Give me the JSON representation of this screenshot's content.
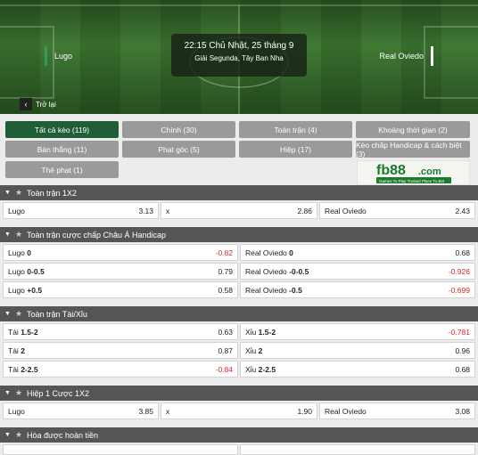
{
  "match": {
    "home": "Lugo",
    "away": "Real Oviedo",
    "datetime": "22:15 Chủ Nhật, 25 tháng 9",
    "league": "Giải Segunda, Tây Ban Nha",
    "back_label": "Trở lại"
  },
  "filters": [
    {
      "label": "Tất cả kèo (119)",
      "active": true
    },
    {
      "label": "Chính (30)"
    },
    {
      "label": "Toàn trận (4)"
    },
    {
      "label": "Khoảng thời gian (2)"
    },
    {
      "label": "Bàn thắng (11)"
    },
    {
      "label": "Phạt góc (5)"
    },
    {
      "label": "Hiệp (17)"
    },
    {
      "label": "Kèo chấp Handicap & cách biệt (3)"
    },
    {
      "label": "Thẻ phạt (1)"
    }
  ],
  "banner": {
    "brand": "fb88",
    "suffix": ".com",
    "tagline": "Games To Play  Trusted Place To Bet"
  },
  "sections": [
    {
      "title": "Toàn trận 1X2",
      "cells": [
        [
          "Lugo",
          "3.13"
        ],
        [
          "x",
          "2.86"
        ],
        [
          "Real Oviedo",
          "2.43"
        ]
      ]
    },
    {
      "title": "Toàn trận cược chấp Châu Á Handicap",
      "rows": [
        [
          [
            "Lugo",
            "0",
            "-0.82"
          ],
          [
            "Real Oviedo",
            "0",
            "0.68"
          ]
        ],
        [
          [
            "Lugo",
            "0-0.5",
            "0.79"
          ],
          [
            "Real Oviedo",
            "-0-0.5",
            "-0.926"
          ]
        ],
        [
          [
            "Lugo",
            "+0.5",
            "0.58"
          ],
          [
            "Real Oviedo",
            "-0.5",
            "-0.699"
          ]
        ]
      ]
    },
    {
      "title": "Toàn trận Tài/Xỉu",
      "rows": [
        [
          [
            "Tài",
            "1.5-2",
            "0.63"
          ],
          [
            "Xỉu",
            "1.5-2",
            "-0.781"
          ]
        ],
        [
          [
            "Tài",
            "2",
            "0.87"
          ],
          [
            "Xỉu",
            "2",
            "0.96"
          ]
        ],
        [
          [
            "Tài",
            "2-2.5",
            "-0.84"
          ],
          [
            "Xỉu",
            "2-2.5",
            "0.68"
          ]
        ]
      ]
    },
    {
      "title": "Hiệp 1 Cược 1X2",
      "cells": [
        [
          "Lugo",
          "3.85"
        ],
        [
          "x",
          "1.90"
        ],
        [
          "Real Oviedo",
          "3.08"
        ]
      ]
    },
    {
      "title": "Hòa được hoàn tiền"
    }
  ],
  "colors": {
    "accent": "#1f5e36",
    "negative": "#d42a2a",
    "header": "#555555"
  }
}
